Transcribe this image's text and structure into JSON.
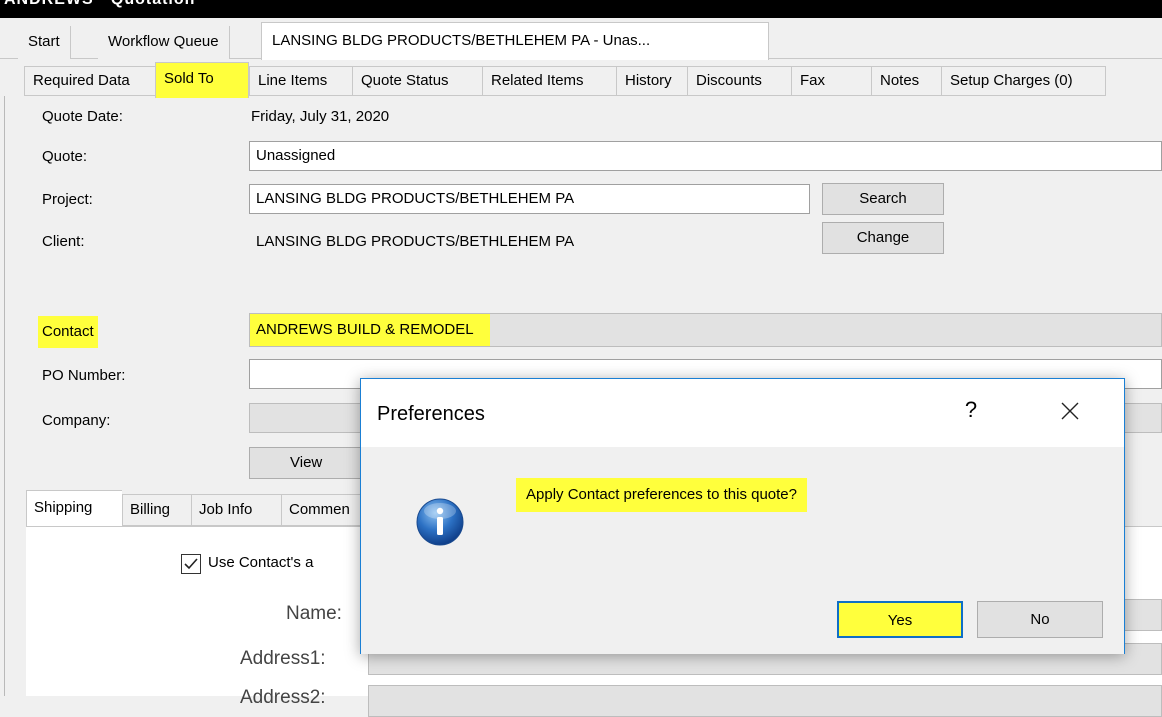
{
  "window_title_fragment": "ANDREWS · Quotation",
  "doc_tabs": [
    {
      "label": "Start"
    },
    {
      "label": "Workflow Queue"
    },
    {
      "label": "LANSING BLDG PRODUCTS/BETHLEHEM PA - Unas..."
    }
  ],
  "inner_tabs": [
    {
      "label": "Required Data"
    },
    {
      "label": "Sold To"
    },
    {
      "label": "Line Items"
    },
    {
      "label": "Quote Status"
    },
    {
      "label": "Related Items"
    },
    {
      "label": "History"
    },
    {
      "label": "Discounts"
    },
    {
      "label": "Fax"
    },
    {
      "label": "Notes"
    },
    {
      "label": "Setup Charges (0)"
    }
  ],
  "form": {
    "quote_date_label": "Quote Date:",
    "quote_date_value": "Friday, July 31, 2020",
    "quote_label": "Quote:",
    "quote_value": "Unassigned",
    "project_label": "Project:",
    "project_value": "LANSING BLDG PRODUCTS/BETHLEHEM PA",
    "search_button": "Search",
    "client_label": "Client:",
    "client_value": "LANSING BLDG PRODUCTS/BETHLEHEM PA",
    "change_button": "Change",
    "contact_label": "Contact",
    "contact_value": "ANDREWS BUILD & REMODEL",
    "po_label": "PO Number:",
    "po_value": "",
    "company_label": "Company:",
    "company_value": "",
    "view_button": "View"
  },
  "lower_tabs": [
    {
      "label": "Shipping"
    },
    {
      "label": "Billing"
    },
    {
      "label": "Job Info"
    },
    {
      "label": "Commen"
    }
  ],
  "shipping": {
    "use_contact_label": "Use Contact's  a",
    "use_contact_checked": true,
    "name_label": "Name:",
    "address1_label": "Address1:",
    "address2_label": "Address2:"
  },
  "dialog": {
    "title": "Preferences",
    "help_glyph": "?",
    "message": "Apply Contact preferences to this quote?",
    "icon": "info-icon",
    "yes_label": "Yes",
    "no_label": "No"
  },
  "colors": {
    "highlight": "#ffff3c",
    "dialog_border": "#1a7fd4",
    "default_button_border": "#0f6fc6",
    "window_bg": "#f0f0f0"
  }
}
